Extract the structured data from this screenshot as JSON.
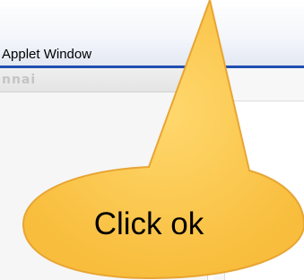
{
  "window": {
    "title": "Applet Window"
  },
  "panel": {
    "label": "nnai"
  },
  "callout": {
    "text": "Click ok",
    "fill_color": "#fcc54a",
    "border_color": "#e8a533"
  },
  "colors": {
    "title_bar_underline": "#1f4fb0",
    "panel_header_text": "#c4c4c4"
  }
}
